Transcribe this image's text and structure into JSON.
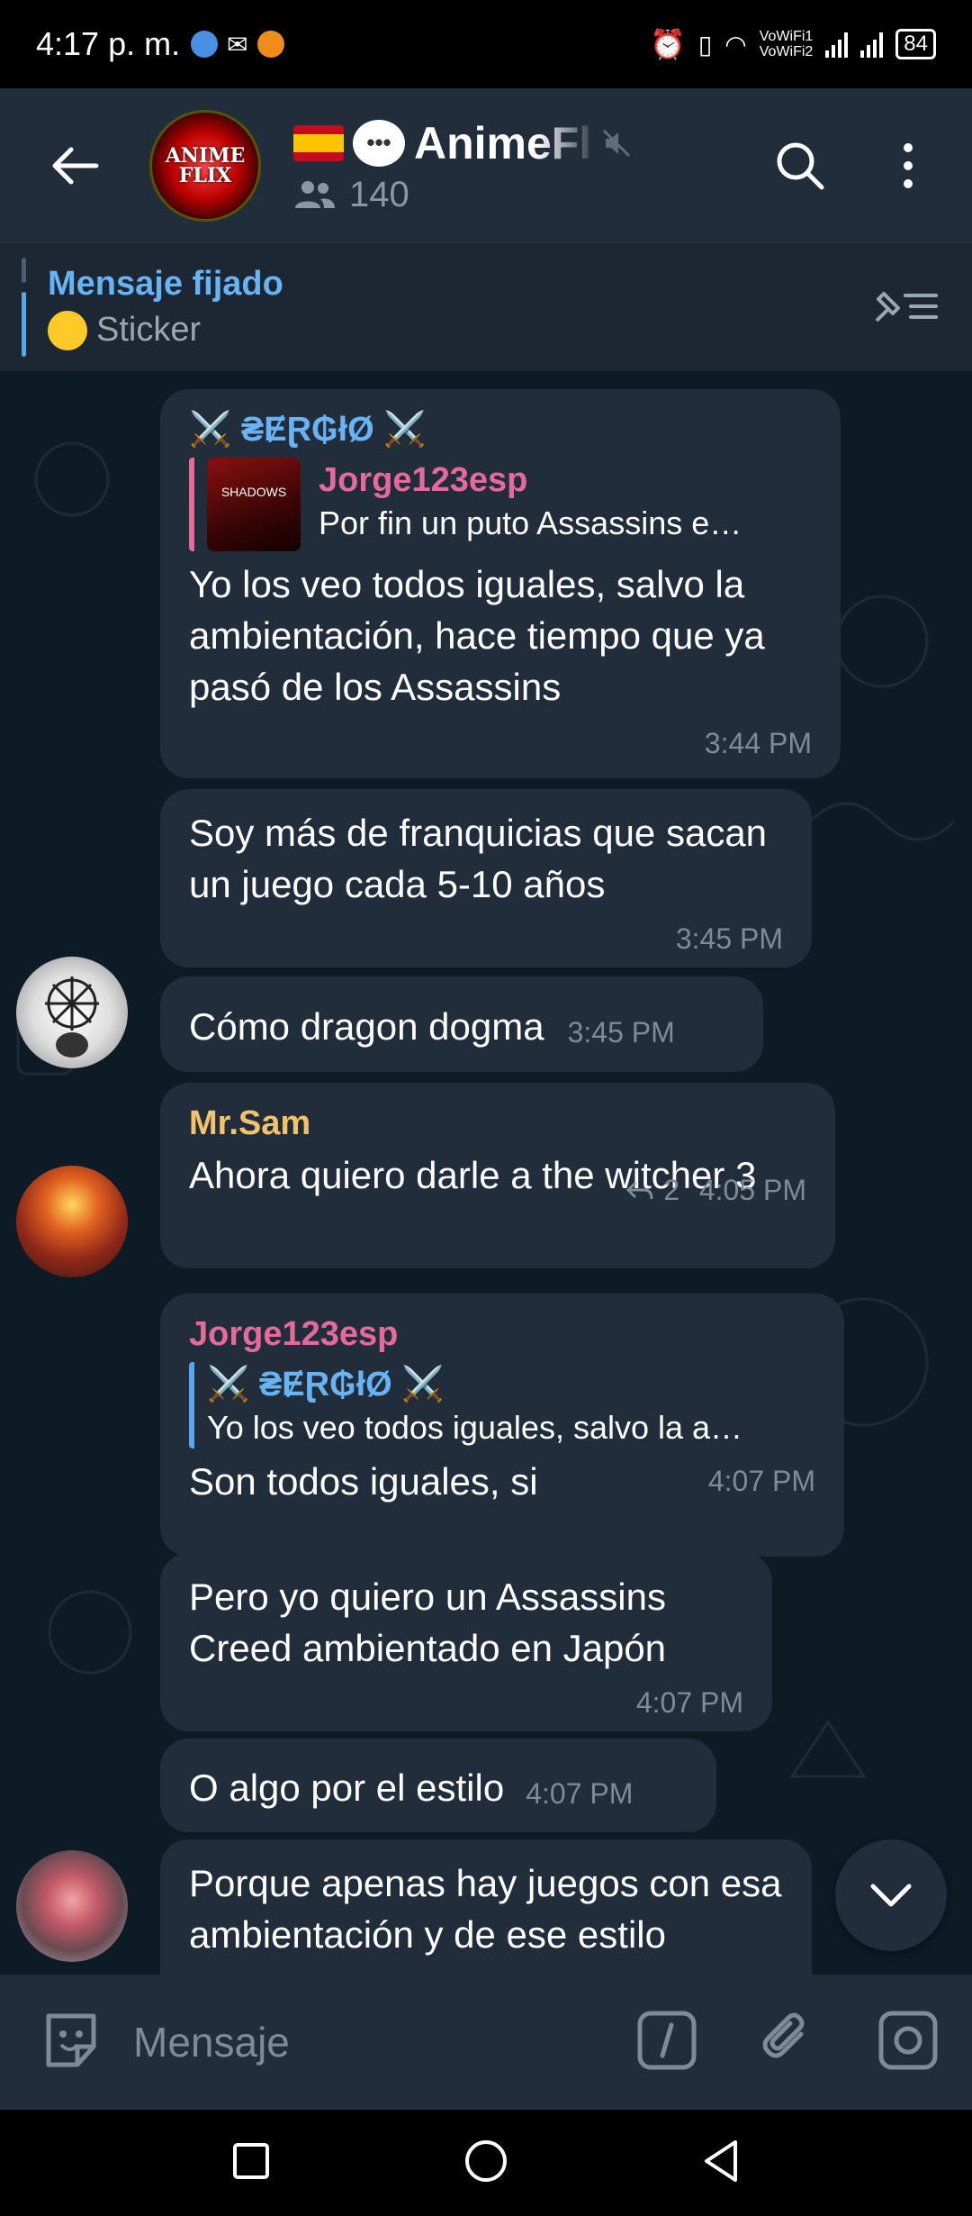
{
  "status_bar": {
    "time": "4:17 p. m.",
    "network_1": "VoWiFi1",
    "network_2": "VoWiFi2",
    "battery": "84"
  },
  "header": {
    "avatar_text_1": "ANIME",
    "avatar_text_2": "FLIX",
    "title": "AnimeFl",
    "members": "140"
  },
  "pinned": {
    "title": "Mensaje fijado",
    "preview": "Sticker"
  },
  "messages": [
    {
      "sender": "⚔️ ₴ɆⱤ₲łØ ⚔️",
      "reply_to": "Jorge123esp",
      "reply_text": "Por fin un puto Assassins e…",
      "thumb_text": "SHADOWS",
      "text": "Yo los veo todos iguales, salvo la ambientación, hace tiempo que ya pasó de los Assassins",
      "time": "3:44 PM"
    },
    {
      "text": "Soy más de franquicias que sacan un juego cada 5-10 años",
      "time": "3:45 PM"
    },
    {
      "text": "Cómo dragon dogma",
      "time": "3:45 PM"
    },
    {
      "sender": "Mr.Sam",
      "text": "Ahora quiero darle a the witcher 3",
      "replies": "2",
      "time": "4:05 PM"
    },
    {
      "sender": "Jorge123esp",
      "reply_to": "⚔️ ₴ɆⱤ₲łØ ⚔️",
      "reply_text": "Yo los veo todos iguales, salvo la a…",
      "text": "Son todos iguales, si",
      "time": "4:07 PM"
    },
    {
      "text": "Pero yo quiero un Assassins Creed ambientado en Japón",
      "time": "4:07 PM"
    },
    {
      "text": "O algo por el estilo",
      "time": "4:07 PM"
    },
    {
      "text": "Porque apenas hay juegos con esa ambientación y de ese estilo"
    }
  ],
  "input": {
    "placeholder": "Mensaje"
  },
  "colors": {
    "header_bg": "#212d3b",
    "chat_bg": "#0d1b26",
    "bubble_bg": "#212d3b",
    "accent_blue": "#67b3f4",
    "sender_pink": "#e56a9a",
    "sender_yellow": "#f1c36b"
  }
}
